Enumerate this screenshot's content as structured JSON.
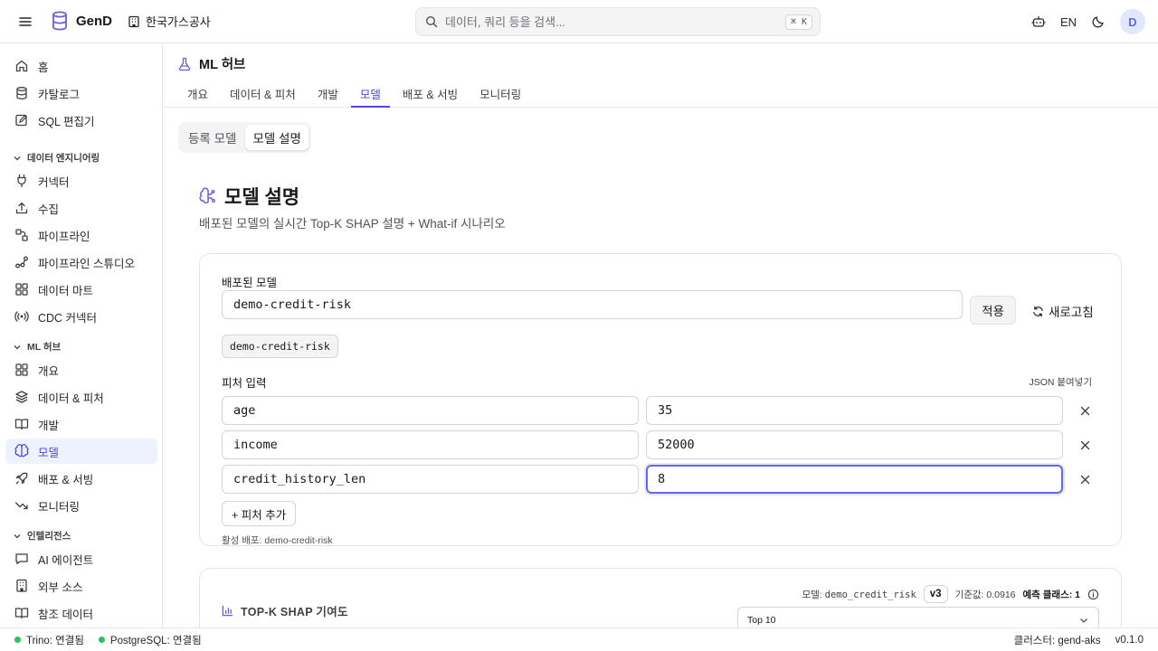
{
  "topbar": {
    "brand": "GenD",
    "org": "한국가스공사",
    "search_placeholder": "데이터, 쿼리 등을 검색...",
    "shortcut": "⌘ K",
    "lang": "EN",
    "avatar": "D"
  },
  "sidebar": {
    "items_top": [
      {
        "label": "홈",
        "icon": "home-icon"
      },
      {
        "label": "카탈로그",
        "icon": "database-icon"
      },
      {
        "label": "SQL 편집기",
        "icon": "edit-icon"
      }
    ],
    "sections": [
      {
        "title": "데이터 엔지니어링",
        "items": [
          {
            "label": "커넥터",
            "icon": "plug-icon"
          },
          {
            "label": "수집",
            "icon": "upload-icon"
          },
          {
            "label": "파이프라인",
            "icon": "pipeline-icon"
          },
          {
            "label": "파이프라인 스튜디오",
            "icon": "workflow-icon"
          },
          {
            "label": "데이터 마트",
            "icon": "grid-icon"
          },
          {
            "label": "CDC 커넥터",
            "icon": "radio-icon"
          }
        ]
      },
      {
        "title": "ML 허브",
        "items": [
          {
            "label": "개요",
            "icon": "grid-icon"
          },
          {
            "label": "데이터 & 피처",
            "icon": "layers-icon"
          },
          {
            "label": "개발",
            "icon": "book-icon"
          },
          {
            "label": "모델",
            "icon": "brain-icon"
          },
          {
            "label": "배포 & 서빙",
            "icon": "rocket-icon"
          },
          {
            "label": "모니터링",
            "icon": "trend-icon"
          }
        ]
      },
      {
        "title": "인텔리전스",
        "items": [
          {
            "label": "AI 에이전트",
            "icon": "chat-icon"
          },
          {
            "label": "외부 소스",
            "icon": "building-icon"
          },
          {
            "label": "참조 데이터",
            "icon": "book-icon"
          }
        ]
      }
    ]
  },
  "page": {
    "title": "ML 허브",
    "tabs": [
      "개요",
      "데이터 & 피처",
      "개발",
      "모델",
      "배포 & 서빙",
      "모니터링"
    ],
    "active_tab": "모델",
    "segments": [
      "등록 모델",
      "모델 설명"
    ],
    "section_title": "모델 설명",
    "section_desc": "배포된 모델의 실시간 Top-K SHAP 설명 + What-if 시나리오"
  },
  "form": {
    "model_label": "배포된 모델",
    "model_value": "demo-credit-risk",
    "apply_label": "적용",
    "refresh_label": "새로고침",
    "chip": "demo-credit-risk",
    "features_label": "피처 입력",
    "json_paste": "JSON 붙여넣기",
    "features": [
      {
        "name": "age",
        "value": "35"
      },
      {
        "name": "income",
        "value": "52000"
      },
      {
        "name": "credit_history_len",
        "value": "8"
      }
    ],
    "add_feature": "+ 피처 추가",
    "active_deploy": "활성 배포: demo-credit-risk"
  },
  "shap": {
    "title": "TOP-K SHAP 기여도",
    "model_prefix": "모델:",
    "model_name": "demo_credit_risk",
    "version": "v3",
    "baseline": "기준값: 0.0916",
    "pred_class": "예측 클래스: 1",
    "topk": "Top 10"
  },
  "status": {
    "trino": "Trino: 연결됨",
    "postgres": "PostgreSQL: 연결됨",
    "cluster": "클러스터: gend-aks",
    "version": "v0.1.0"
  },
  "colors": {
    "accent": "#4f46e5",
    "ok": "#22c55e"
  }
}
